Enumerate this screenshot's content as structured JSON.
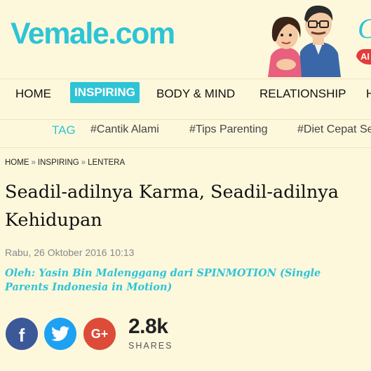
{
  "site": {
    "logo": "Vemale.com"
  },
  "promo": {
    "partial_letter": "C",
    "badge_text": "AI"
  },
  "nav": {
    "items": [
      {
        "label": "HOME",
        "active": false
      },
      {
        "label": "INSPIRING",
        "active": true
      },
      {
        "label": "BODY & MIND",
        "active": false
      },
      {
        "label": "RELATIONSHIP",
        "active": false
      },
      {
        "label": "H",
        "active": false
      }
    ]
  },
  "tags": {
    "label": "TAG",
    "items": [
      "#Cantik Alami",
      "#Tips Parenting",
      "#Diet Cepat Se"
    ]
  },
  "breadcrumb": {
    "items": [
      "HOME",
      "INSPIRING",
      "LENTERA"
    ],
    "separator": "»"
  },
  "article": {
    "title_line1": "Seadil-adilnya Karma, Seadil-adilnya",
    "title_line2": "Kehidupan",
    "date": "Rabu, 26 Oktober 2016 10:13",
    "author_line1": "Oleh: Yasin Bin Malenggang dari SPINMOTION (Single",
    "author_line2": "Parents Indonesia in Motion)"
  },
  "share": {
    "buttons": [
      {
        "name": "facebook",
        "glyph": "f"
      },
      {
        "name": "twitter",
        "glyph": "t"
      },
      {
        "name": "google-plus",
        "glyph": "G+"
      }
    ],
    "count": "2.8k",
    "label": "SHARES"
  },
  "colors": {
    "accent": "#2ec4d6",
    "background": "#fdf8dc",
    "facebook": "#3b5998",
    "twitter": "#1da1f2",
    "google_plus": "#dd4b39"
  }
}
